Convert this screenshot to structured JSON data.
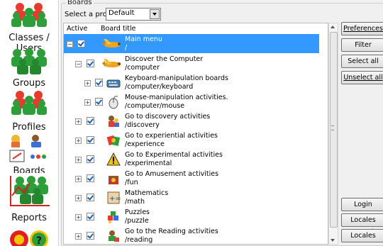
{
  "sidebar": {
    "items": [
      {
        "label": "Classes / Users",
        "icon": "classes-users-icon"
      },
      {
        "label": "Groups",
        "icon": "groups-icon"
      },
      {
        "label": "Profiles",
        "icon": "profiles-icon"
      },
      {
        "label": "Boards",
        "icon": "boards-icon"
      },
      {
        "label": "Reports",
        "icon": "reports-icon"
      }
    ]
  },
  "boards": {
    "group_title": "Boards",
    "profile_label": "Select a profile:",
    "profile_value": "Default",
    "columns": {
      "active": "Active",
      "title": "Board title"
    },
    "rows": [
      {
        "title": "Main menu",
        "path": "/",
        "icon": "airplane-icon"
      },
      {
        "title": "Discover the Computer",
        "path": "/computer",
        "icon": "airplane-icon"
      },
      {
        "title": "Keyboard-manipulation boards",
        "path": "/computer/keyboard",
        "icon": "keyboard-icon"
      },
      {
        "title": "Mouse-manipulation activities.",
        "path": "/computer/mouse",
        "icon": "mouse-icon"
      },
      {
        "title": "Go to discovery activities",
        "path": "/discovery",
        "icon": "discovery-icon"
      },
      {
        "title": "Go to experiential activities",
        "path": "/experience",
        "icon": "experience-icon"
      },
      {
        "title": "Go to Experimental activities",
        "path": "/experimental",
        "icon": "warning-icon"
      },
      {
        "title": "Go to Amusement activities",
        "path": "/fun",
        "icon": "fun-icon"
      },
      {
        "title": "Mathematics",
        "path": "/math",
        "icon": "math-icon"
      },
      {
        "title": "Puzzles",
        "path": "/puzzle",
        "icon": "puzzle-icon"
      },
      {
        "title": "Go to the Reading activities",
        "path": "/reading",
        "icon": "reading-icon"
      }
    ]
  },
  "buttons": {
    "preferences": "Preferences",
    "filter": "Filter",
    "select_all": "Select all",
    "unselect_all": "Unselect all",
    "login": "Login",
    "locales_sound": "Locales sound",
    "locales": "Locales"
  }
}
